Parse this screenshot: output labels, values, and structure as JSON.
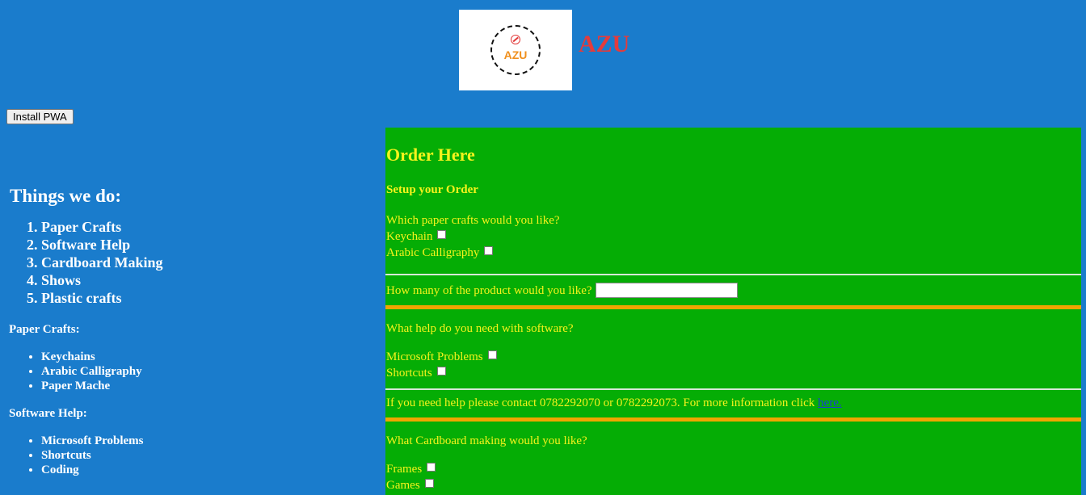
{
  "header": {
    "logo_text": "AZU",
    "brand_title": "AZU",
    "install_button": "Install PWA"
  },
  "things": {
    "heading": "Things we do:",
    "items": [
      "Paper Crafts",
      "Software Help",
      "Cardboard Making",
      "Shows",
      "Plastic crafts"
    ]
  },
  "paper_crafts": {
    "heading": "Paper Crafts:",
    "items": [
      "Keychains",
      "Arabic Calligraphy",
      "Paper Mache"
    ]
  },
  "software_help": {
    "heading": "Software Help:",
    "items": [
      "Microsoft Problems",
      "Shortcuts",
      "Coding"
    ]
  },
  "order": {
    "title": "Order Here",
    "setup": "Setup your Order",
    "paper_question": "Which paper crafts would you like?",
    "paper_options": [
      "Keychain",
      "Arabic Calligraphy"
    ],
    "quantity_question": "How many of the product would you like?",
    "quantity_value": "",
    "software_question": "What help do you need with software?",
    "software_options": [
      "Microsoft Problems",
      "Shortcuts"
    ],
    "contact_text": "If you need help please contact 0782292070 or 0782292073. For more information click",
    "contact_link": "here.",
    "cardboard_question": "What Cardboard making would you like?",
    "cardboard_options": [
      "Frames",
      "Games"
    ]
  },
  "colors": {
    "page_bg": "#1a7ccc",
    "panel_bg": "#05ad05",
    "panel_text": "#f5f31c",
    "divider_accent": "#f0a500",
    "brand_red": "#e43b3b"
  }
}
